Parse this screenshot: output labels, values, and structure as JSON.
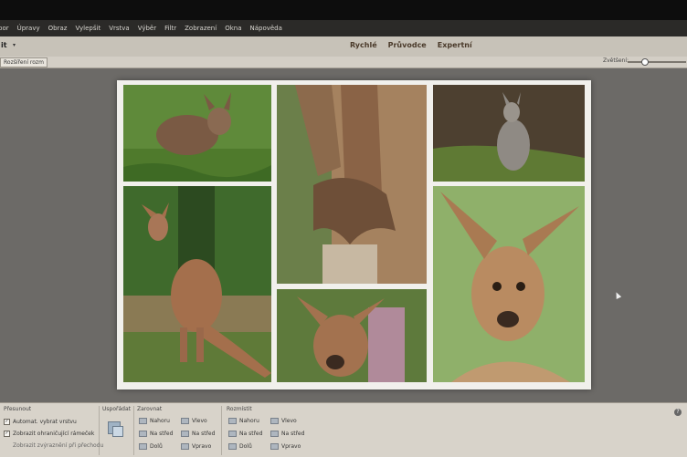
{
  "menu": [
    "bor",
    "Úpravy",
    "Obraz",
    "Vylepšit",
    "Vrstva",
    "Výběr",
    "Filtr",
    "Zobrazení",
    "Okna",
    "Nápověda"
  ],
  "modebar": {
    "left_label": "it",
    "caret": "▾",
    "modes": [
      "Rychlé",
      "Průvodce",
      "Expertní"
    ]
  },
  "options": {
    "button": "Rozšíření rozm",
    "zoom_label": "Zvětšení:",
    "zoom_level": 0.25
  },
  "colors": {
    "menu_bg": "#2b2a28",
    "workspace": "#6c6a67",
    "panel": "#d8d3ca",
    "mode_text": "#4a3a2a"
  },
  "collage": {
    "photos": [
      {
        "name": "kangaroo-grass-top-left",
        "icon": "kangaroo"
      },
      {
        "name": "kangaroo-paw-closeup",
        "icon": "kangaroo-paw"
      },
      {
        "name": "wallaby-sitting-top-right",
        "icon": "kangaroo"
      },
      {
        "name": "kangaroo-standing-left",
        "icon": "kangaroo"
      },
      {
        "name": "kangaroo-face-center",
        "icon": "kangaroo"
      },
      {
        "name": "kangaroo-portrait-right",
        "icon": "kangaroo"
      }
    ]
  },
  "panel": {
    "move": {
      "title": "Přesunout",
      "auto_select": "Automat. vybrat vrstvu",
      "show_bbox": "Zobrazit ohraničující rámeček",
      "show_highlight": "Zobrazit zvýraznění při přechodu",
      "auto_select_checked": true,
      "show_bbox_checked": true
    },
    "arrange": {
      "title": "Uspořádat"
    },
    "align": {
      "title": "Zarovnat",
      "top": "Nahoru",
      "center": "Na střed",
      "bottom": "Dolů",
      "left": "Vlevo",
      "middle": "Na střed",
      "right": "Vpravo"
    },
    "distribute": {
      "title": "Rozmístit",
      "top": "Nahoru",
      "center": "Na střed",
      "bottom": "Dolů",
      "left": "Vlevo",
      "middle": "Na střed",
      "right": "Vpravo"
    },
    "help": "?"
  }
}
